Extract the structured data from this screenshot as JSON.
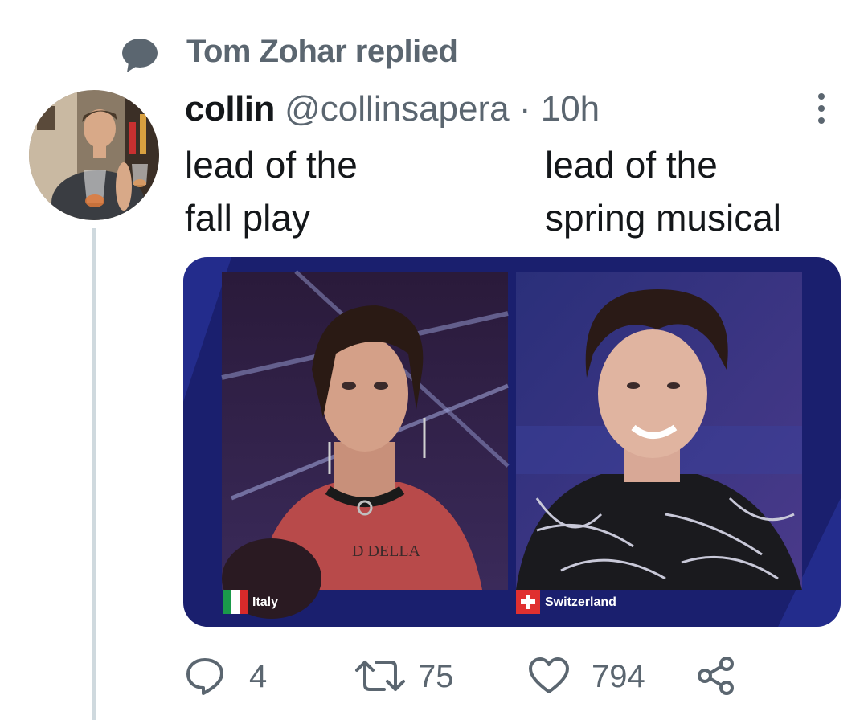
{
  "reply_context": {
    "text": "Tom Zohar replied",
    "icon": "speech-bubble-icon"
  },
  "tweet": {
    "author_name": "collin",
    "author_handle": "@collinsapera",
    "separator": "·",
    "timestamp": "10h",
    "text_left": [
      "lead of the",
      "fall play"
    ],
    "text_right": [
      "lead of the",
      "spring musical"
    ],
    "media": {
      "left_caption": "Italy",
      "right_caption": "Switzerland",
      "tattoo_text": "D DELLA"
    },
    "actions": {
      "reply": {
        "icon": "reply-icon",
        "count": "4"
      },
      "retweet": {
        "icon": "retweet-icon",
        "count": "75"
      },
      "like": {
        "icon": "heart-icon",
        "count": "794"
      },
      "share": {
        "icon": "share-icon"
      }
    }
  },
  "colors": {
    "text_primary": "#14171a",
    "text_secondary": "#5b6670",
    "thread_line": "#cfd9de",
    "media_frame": "#1a1f6e"
  }
}
